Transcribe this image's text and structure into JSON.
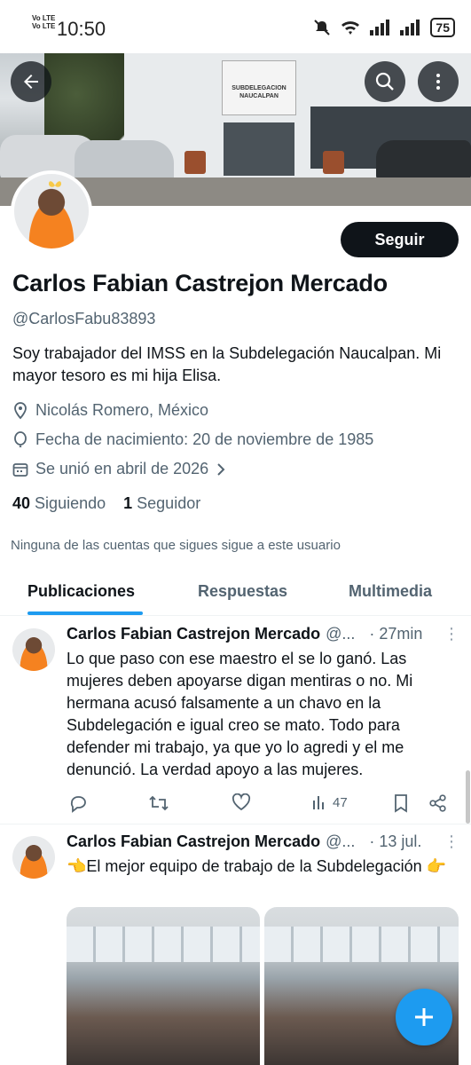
{
  "status_bar": {
    "time": "10:50",
    "lte_top": "Vo LTE",
    "lte_bottom": "Vo LTE",
    "battery": "75"
  },
  "banner": {
    "sign_text": "SUBDELEGACION NAUCALPAN"
  },
  "profile": {
    "follow_label": "Seguir",
    "name": "Carlos Fabian Castrejon Mercado",
    "handle": "@CarlosFabu83893",
    "bio": "Soy trabajador del IMSS en la Subdelegación Naucalpan. Mi mayor tesoro es mi hija Elisa.",
    "location": "Nicolás Romero, México",
    "birthday": "Fecha de nacimiento: 20 de noviembre de 1985",
    "joined": "Se unió en abril de 2026",
    "following_count": "40",
    "following_label": "Siguiendo",
    "followers_count": "1",
    "followers_label": "Seguidor",
    "mutual_note": "Ninguna de las cuentas que sigues sigue a este usuario"
  },
  "tabs": [
    "Publicaciones",
    "Respuestas",
    "Multimedia"
  ],
  "posts": [
    {
      "name": "Carlos Fabian Castrejon Mercado",
      "sub": "@...",
      "time": "· 27min",
      "text": "Lo que paso con ese maestro el se lo ganó. Las mujeres deben apoyarse digan mentiras o no. Mi hermana acusó falsamente a un chavo en la Subdelegación e igual creo se mato. Todo para defender mi trabajo, ya que yo lo agredi y el me denunció. La verdad  apoyo a las mujeres.",
      "views": "47"
    },
    {
      "name": "Carlos Fabian Castrejon Mercado",
      "sub": "@...",
      "time": "· 13 jul.",
      "text": "👈El mejor equipo de trabajo de la Subdelegación 👉"
    }
  ],
  "colors": {
    "accent": "#1d9bf0",
    "text": "#0f1419",
    "muted": "#536471"
  }
}
